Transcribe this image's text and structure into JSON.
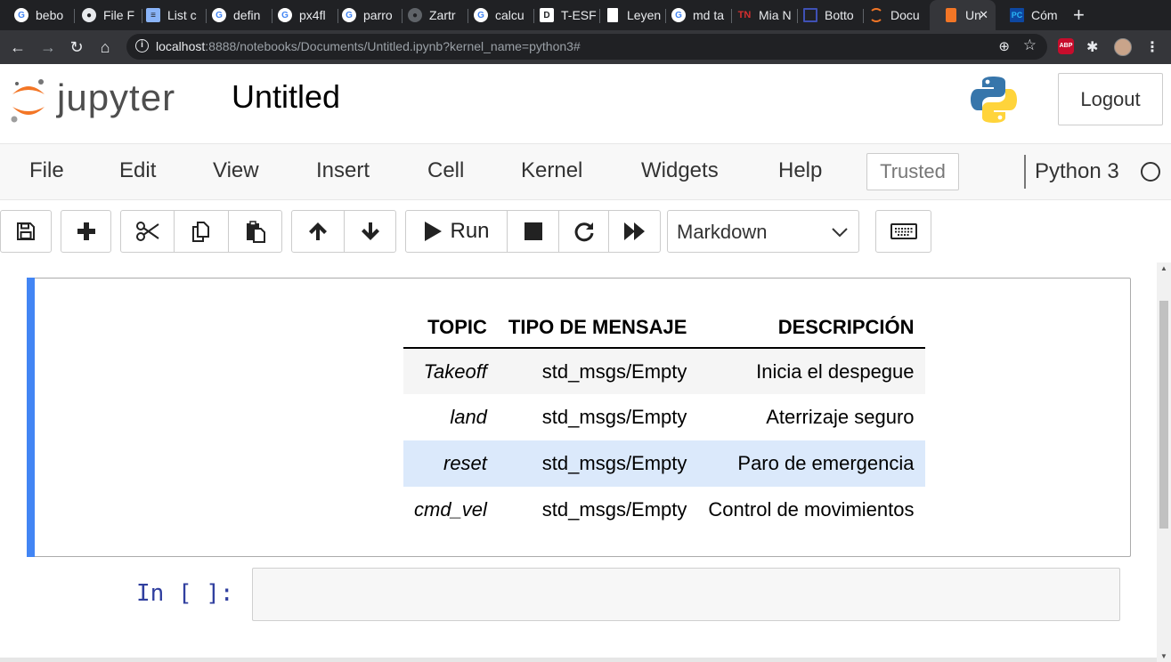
{
  "browser": {
    "tabs": [
      {
        "title": "bebo",
        "favicon": "google-icon",
        "color": "#ffffff"
      },
      {
        "title": "File F",
        "favicon": "github-icon",
        "color": "#e8eaed"
      },
      {
        "title": "List c",
        "favicon": "doc-list-icon",
        "color": "#8ab4f8"
      },
      {
        "title": "defin",
        "favicon": "google-icon",
        "color": "#ffffff"
      },
      {
        "title": "px4fl",
        "favicon": "google-icon",
        "color": "#ffffff"
      },
      {
        "title": "parro",
        "favicon": "google-icon",
        "color": "#ffffff"
      },
      {
        "title": "Zartr",
        "favicon": "github-icon",
        "color": "#5f6368"
      },
      {
        "title": "calcu",
        "favicon": "google-icon",
        "color": "#ffffff"
      },
      {
        "title": "T-ESF",
        "favicon": "d-icon",
        "color": "#ffffff"
      },
      {
        "title": "Leyen",
        "favicon": "page-icon",
        "color": "#ffffff"
      },
      {
        "title": "md ta",
        "favicon": "google-icon",
        "color": "#ffffff"
      },
      {
        "title": "Mia N",
        "favicon": "tn-icon",
        "color": "#d32f2f"
      },
      {
        "title": "Botto",
        "favicon": "square-icon",
        "color": "#3f51b5"
      },
      {
        "title": "Docu",
        "favicon": "jupyter-icon",
        "color": "#f37626"
      },
      {
        "title": "Un",
        "favicon": "book-icon",
        "color": "#f37626"
      },
      {
        "title": "Cóm",
        "favicon": "pc-icon",
        "color": "#29b6f6"
      }
    ],
    "active_tab_index": 14,
    "url_host": "localhost",
    "url_rest": ":8888/notebooks/Documents/Untitled.ipynb?kernel_name=python3#",
    "abp_label": "ABP"
  },
  "jupyter": {
    "brand": "jupyter",
    "notebook_name": "Untitled",
    "logout_label": "Logout",
    "menu": [
      "File",
      "Edit",
      "View",
      "Insert",
      "Cell",
      "Kernel",
      "Widgets",
      "Help"
    ],
    "trusted_label": "Trusted",
    "kernel_name": "Python 3",
    "run_label": "Run",
    "cell_type": "Markdown",
    "accent": "#4285f4"
  },
  "markdown_table": {
    "headers": [
      "TOPIC",
      "TIPO DE MENSAJE",
      "DESCRIPCIÓN"
    ],
    "rows": [
      [
        "Takeoff",
        "std_msgs/Empty",
        "Inicia el despegue"
      ],
      [
        "land",
        "std_msgs/Empty",
        "Aterrizaje seguro"
      ],
      [
        "reset",
        "std_msgs/Empty",
        "Paro de emergencia"
      ],
      [
        "cmd_vel",
        "std_msgs/Empty",
        "Control de movimientos"
      ]
    ]
  },
  "code_cell": {
    "prompt": "In [ ]:"
  }
}
